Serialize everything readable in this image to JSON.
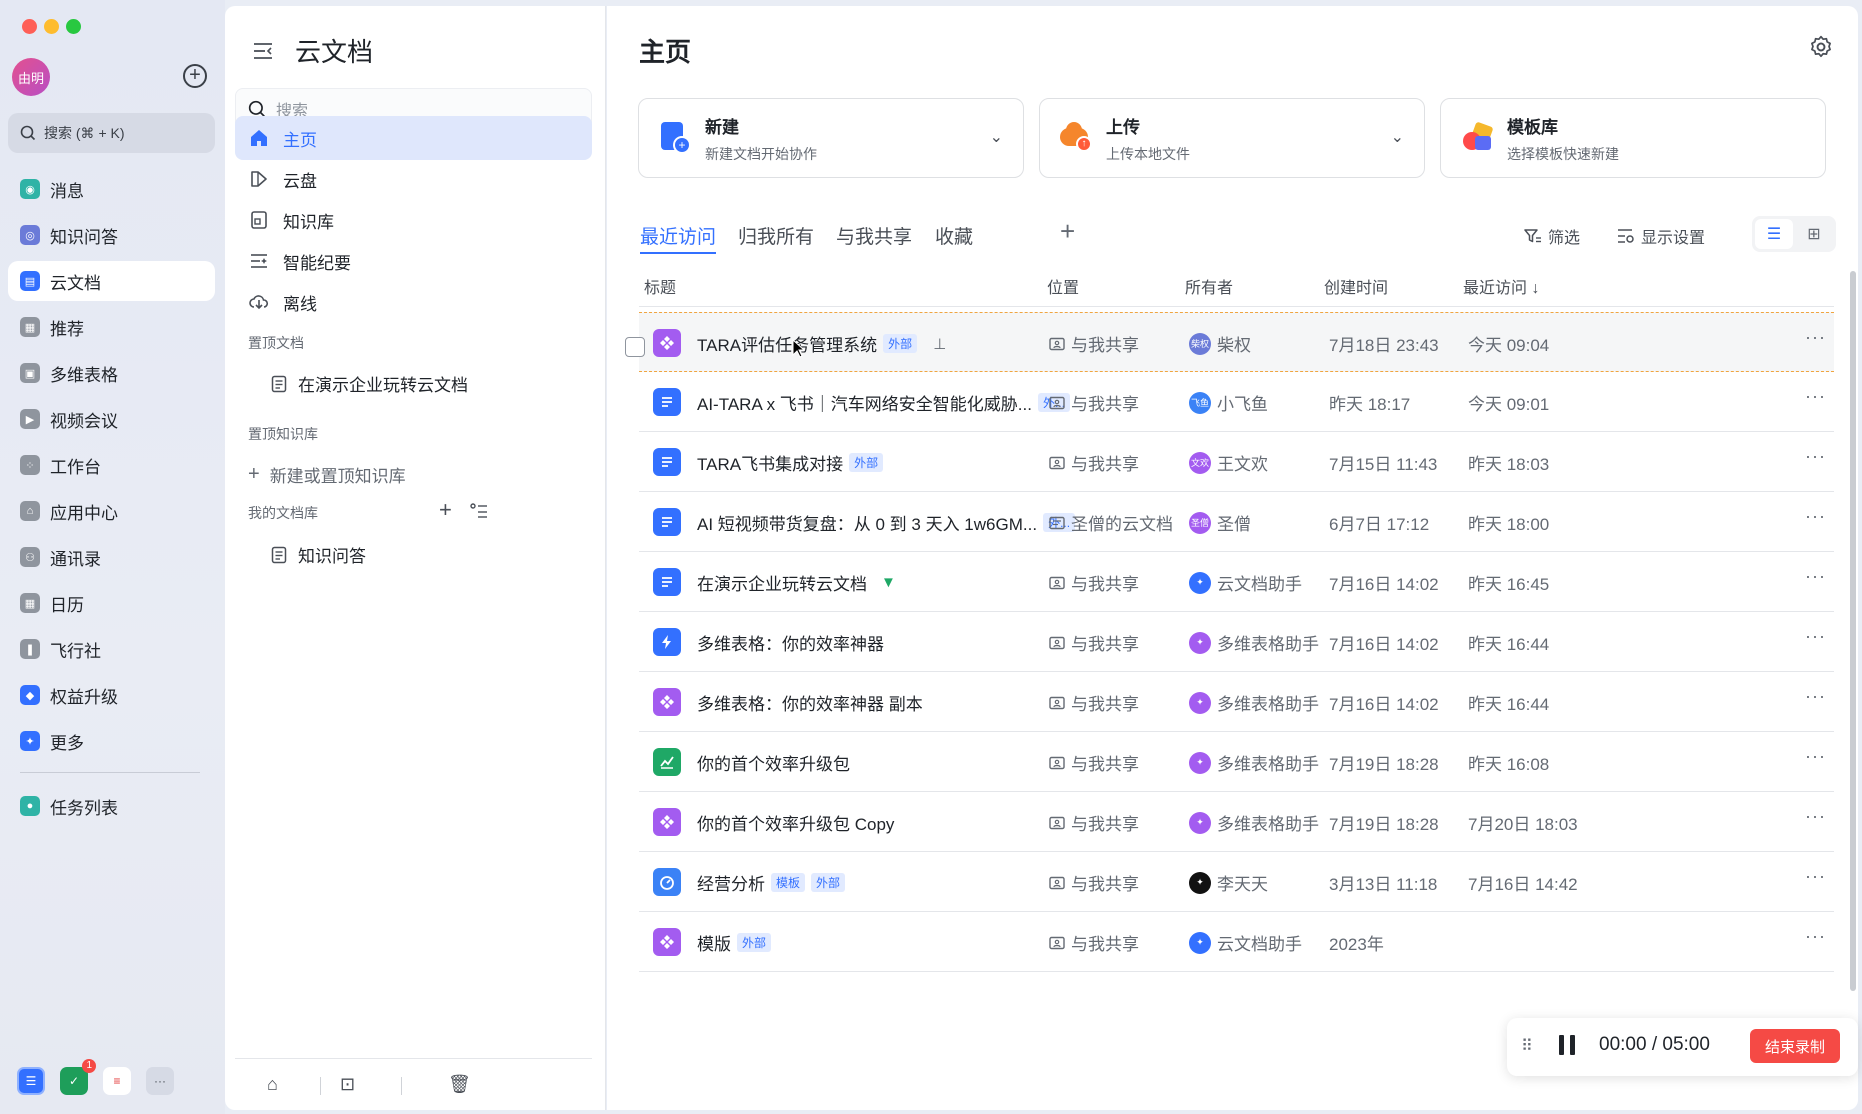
{
  "rail": {
    "avatar_text": "由明",
    "search_label": "搜索 (⌘ + K)",
    "items": [
      {
        "label": "消息",
        "icon": "message-icon",
        "color": "#2fb3a6"
      },
      {
        "label": "知识问答",
        "icon": "qa-icon",
        "color": "#6b7bd8"
      },
      {
        "label": "云文档",
        "icon": "cloud-doc-icon",
        "color": "#3370ff"
      },
      {
        "label": "推荐",
        "icon": "recommend-icon",
        "color": "#8f959e"
      },
      {
        "label": "多维表格",
        "icon": "base-icon",
        "color": "#8f959e"
      },
      {
        "label": "视频会议",
        "icon": "video-icon",
        "color": "#8f959e"
      },
      {
        "label": "工作台",
        "icon": "workplace-icon",
        "color": "#8f959e"
      },
      {
        "label": "应用中心",
        "icon": "app-center-icon",
        "color": "#8f959e"
      },
      {
        "label": "通讯录",
        "icon": "contacts-icon",
        "color": "#8f959e"
      },
      {
        "label": "日历",
        "icon": "calendar-icon",
        "color": "#8f959e"
      },
      {
        "label": "飞行社",
        "icon": "flyer-icon",
        "color": "#8f959e"
      },
      {
        "label": "权益升级",
        "icon": "upgrade-icon",
        "color": "#3370ff"
      },
      {
        "label": "更多",
        "icon": "more-apps-icon",
        "color": "#3370ff"
      }
    ],
    "task_label": "任务列表",
    "bottom_badge": "1"
  },
  "sidebar": {
    "title": "云文档",
    "search_placeholder": "搜索",
    "nav": [
      {
        "label": "主页",
        "icon": "home-icon"
      },
      {
        "label": "云盘",
        "icon": "drive-icon"
      },
      {
        "label": "知识库",
        "icon": "wiki-icon"
      },
      {
        "label": "智能纪要",
        "icon": "minutes-icon"
      },
      {
        "label": "离线",
        "icon": "offline-icon"
      }
    ],
    "pinned_docs_title": "置顶文档",
    "pinned_doc": "在演示企业玩转云文档",
    "pinned_wiki_title": "置顶知识库",
    "pinned_wiki_action": "新建或置顶知识库",
    "my_library_title": "我的文档库",
    "my_library_item": "知识问答"
  },
  "main": {
    "title": "主页",
    "cards": [
      {
        "title": "新建",
        "sub": "新建文档开始协作"
      },
      {
        "title": "上传",
        "sub": "上传本地文件"
      },
      {
        "title": "模板库",
        "sub": "选择模板快速新建"
      }
    ],
    "tabs": [
      "最近访问",
      "归我所有",
      "与我共享",
      "收藏"
    ],
    "filter_label": "筛选",
    "display_label": "显示设置",
    "columns": {
      "title": "标题",
      "location": "位置",
      "owner": "所有者",
      "created": "创建时间",
      "visited": "最近访问 ↓"
    },
    "rows": [
      {
        "title": "TARA评估任务管理系统",
        "badges": [
          "外部"
        ],
        "pin": "outline",
        "type": "base",
        "location": "与我共享",
        "owner": "柴权",
        "owner_av": "柴权",
        "created": "7月18日 23:43",
        "visited": "今天 09:04"
      },
      {
        "title": "AI-TARA x 飞书｜汽车网络安全智能化威胁...",
        "badges": [
          "外..."
        ],
        "pin": "",
        "type": "doc",
        "location": "与我共享",
        "owner": "小飞鱼",
        "owner_av": "飞鱼",
        "created": "昨天 18:17",
        "visited": "今天 09:01"
      },
      {
        "title": "TARA飞书集成对接",
        "badges": [
          "外部"
        ],
        "pin": "",
        "type": "doc",
        "location": "与我共享",
        "owner": "王文欢",
        "owner_av": "文欢",
        "created": "7月15日 11:43",
        "visited": "昨天 18:03"
      },
      {
        "title": "AI 短视频带货复盘：从 0 到 3 天入 1w6GM...",
        "badges": [
          "外..."
        ],
        "pin": "",
        "type": "doc",
        "location": "圣僧的云文档",
        "owner": "圣僧",
        "owner_av": "圣僧",
        "created": "6月7日 17:12",
        "visited": "昨天 18:00"
      },
      {
        "title": "在演示企业玩转云文档",
        "badges": [],
        "pin": "filled",
        "type": "doc",
        "location": "与我共享",
        "owner": "云文档助手",
        "owner_av": "",
        "created": "7月16日 14:02",
        "visited": "昨天 16:45"
      },
      {
        "title": "多维表格：你的效率神器",
        "badges": [],
        "pin": "",
        "type": "flash",
        "location": "与我共享",
        "owner": "多维表格助手",
        "owner_av": "",
        "created": "7月16日 14:02",
        "visited": "昨天 16:44"
      },
      {
        "title": "多维表格：你的效率神器 副本",
        "badges": [],
        "pin": "",
        "type": "base",
        "location": "与我共享",
        "owner": "多维表格助手",
        "owner_av": "",
        "created": "7月16日 14:02",
        "visited": "昨天 16:44"
      },
      {
        "title": "你的首个效率升级包",
        "badges": [],
        "pin": "",
        "type": "chart",
        "location": "与我共享",
        "owner": "多维表格助手",
        "owner_av": "",
        "created": "7月19日 18:28",
        "visited": "昨天 16:08"
      },
      {
        "title": "你的首个效率升级包 Copy",
        "badges": [],
        "pin": "",
        "type": "base",
        "location": "与我共享",
        "owner": "多维表格助手",
        "owner_av": "",
        "created": "7月19日 18:28",
        "visited": "7月20日 18:03"
      },
      {
        "title": "经营分析",
        "badges": [
          "模板",
          "外部"
        ],
        "pin": "",
        "type": "dash",
        "location": "与我共享",
        "owner": "李天天",
        "owner_av": "",
        "created": "3月13日 11:18",
        "visited": "7月16日 14:42"
      },
      {
        "title": "模版",
        "badges": [
          "外部"
        ],
        "pin": "",
        "type": "base",
        "location": "与我共享",
        "owner": "云文档助手",
        "owner_av": "",
        "created": "2023年",
        "visited": ""
      }
    ]
  },
  "recorder": {
    "time": "00:00  /  05:00",
    "stop_label": "结束录制"
  }
}
